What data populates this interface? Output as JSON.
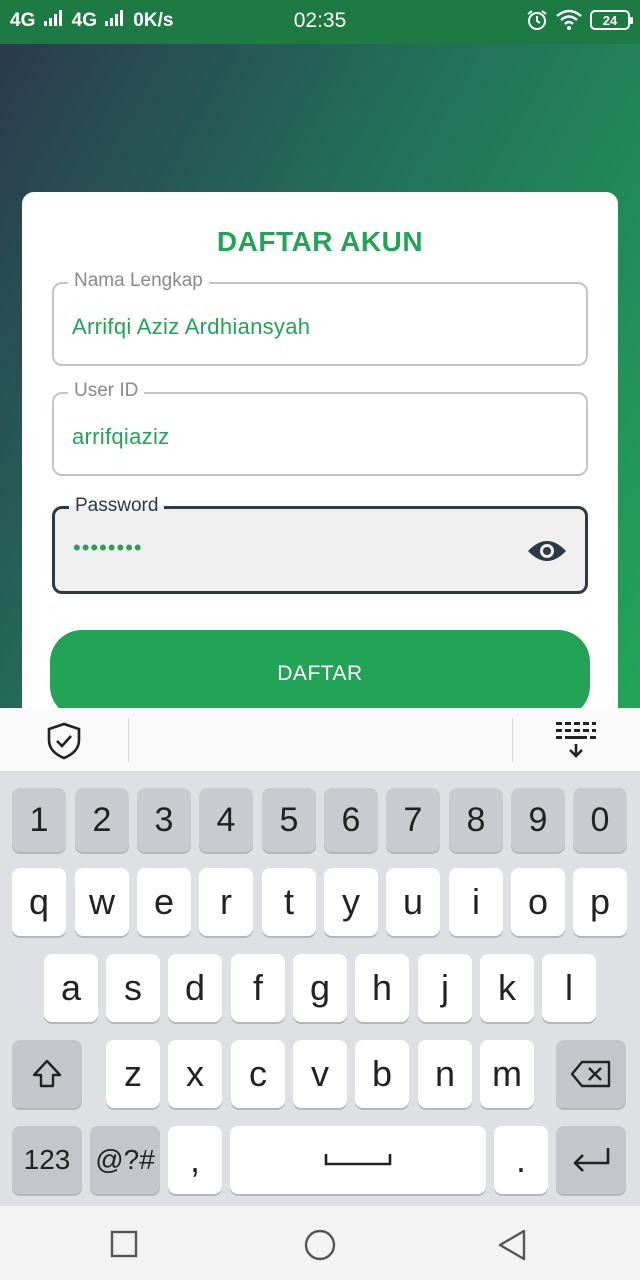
{
  "status": {
    "network1": "4G",
    "network2": "4G",
    "speed": "0K/s",
    "time": "02:35",
    "battery": "24"
  },
  "form": {
    "title": "DAFTAR AKUN",
    "fullname_label": "Nama Lengkap",
    "fullname_value": "Arrifqi Aziz Ardhiansyah",
    "userid_label": "User ID",
    "userid_value": "arrifqiaziz",
    "password_label": "Password",
    "password_value": "••••••••",
    "submit_label": "DAFTAR"
  },
  "keyboard": {
    "row_numbers": [
      "1",
      "2",
      "3",
      "4",
      "5",
      "6",
      "7",
      "8",
      "9",
      "0"
    ],
    "row1": [
      "q",
      "w",
      "e",
      "r",
      "t",
      "y",
      "u",
      "i",
      "o",
      "p"
    ],
    "row2": [
      "a",
      "s",
      "d",
      "f",
      "g",
      "h",
      "j",
      "k",
      "l"
    ],
    "row3": [
      "z",
      "x",
      "c",
      "v",
      "b",
      "n",
      "m"
    ],
    "key_123": "123",
    "key_symbols": "@?#",
    "key_comma": ",",
    "key_period": "."
  },
  "colors": {
    "accent": "#22a356",
    "status_bar": "#1e7a43",
    "focus_border": "#2c3946"
  },
  "icons": [
    "signal-icon",
    "alarm-icon",
    "wifi-icon",
    "battery-icon",
    "eye-icon",
    "shield-check-icon",
    "keyboard-hide-icon",
    "shift-icon",
    "backspace-icon",
    "space-icon",
    "enter-icon",
    "recent-apps-icon",
    "home-icon",
    "back-icon"
  ]
}
